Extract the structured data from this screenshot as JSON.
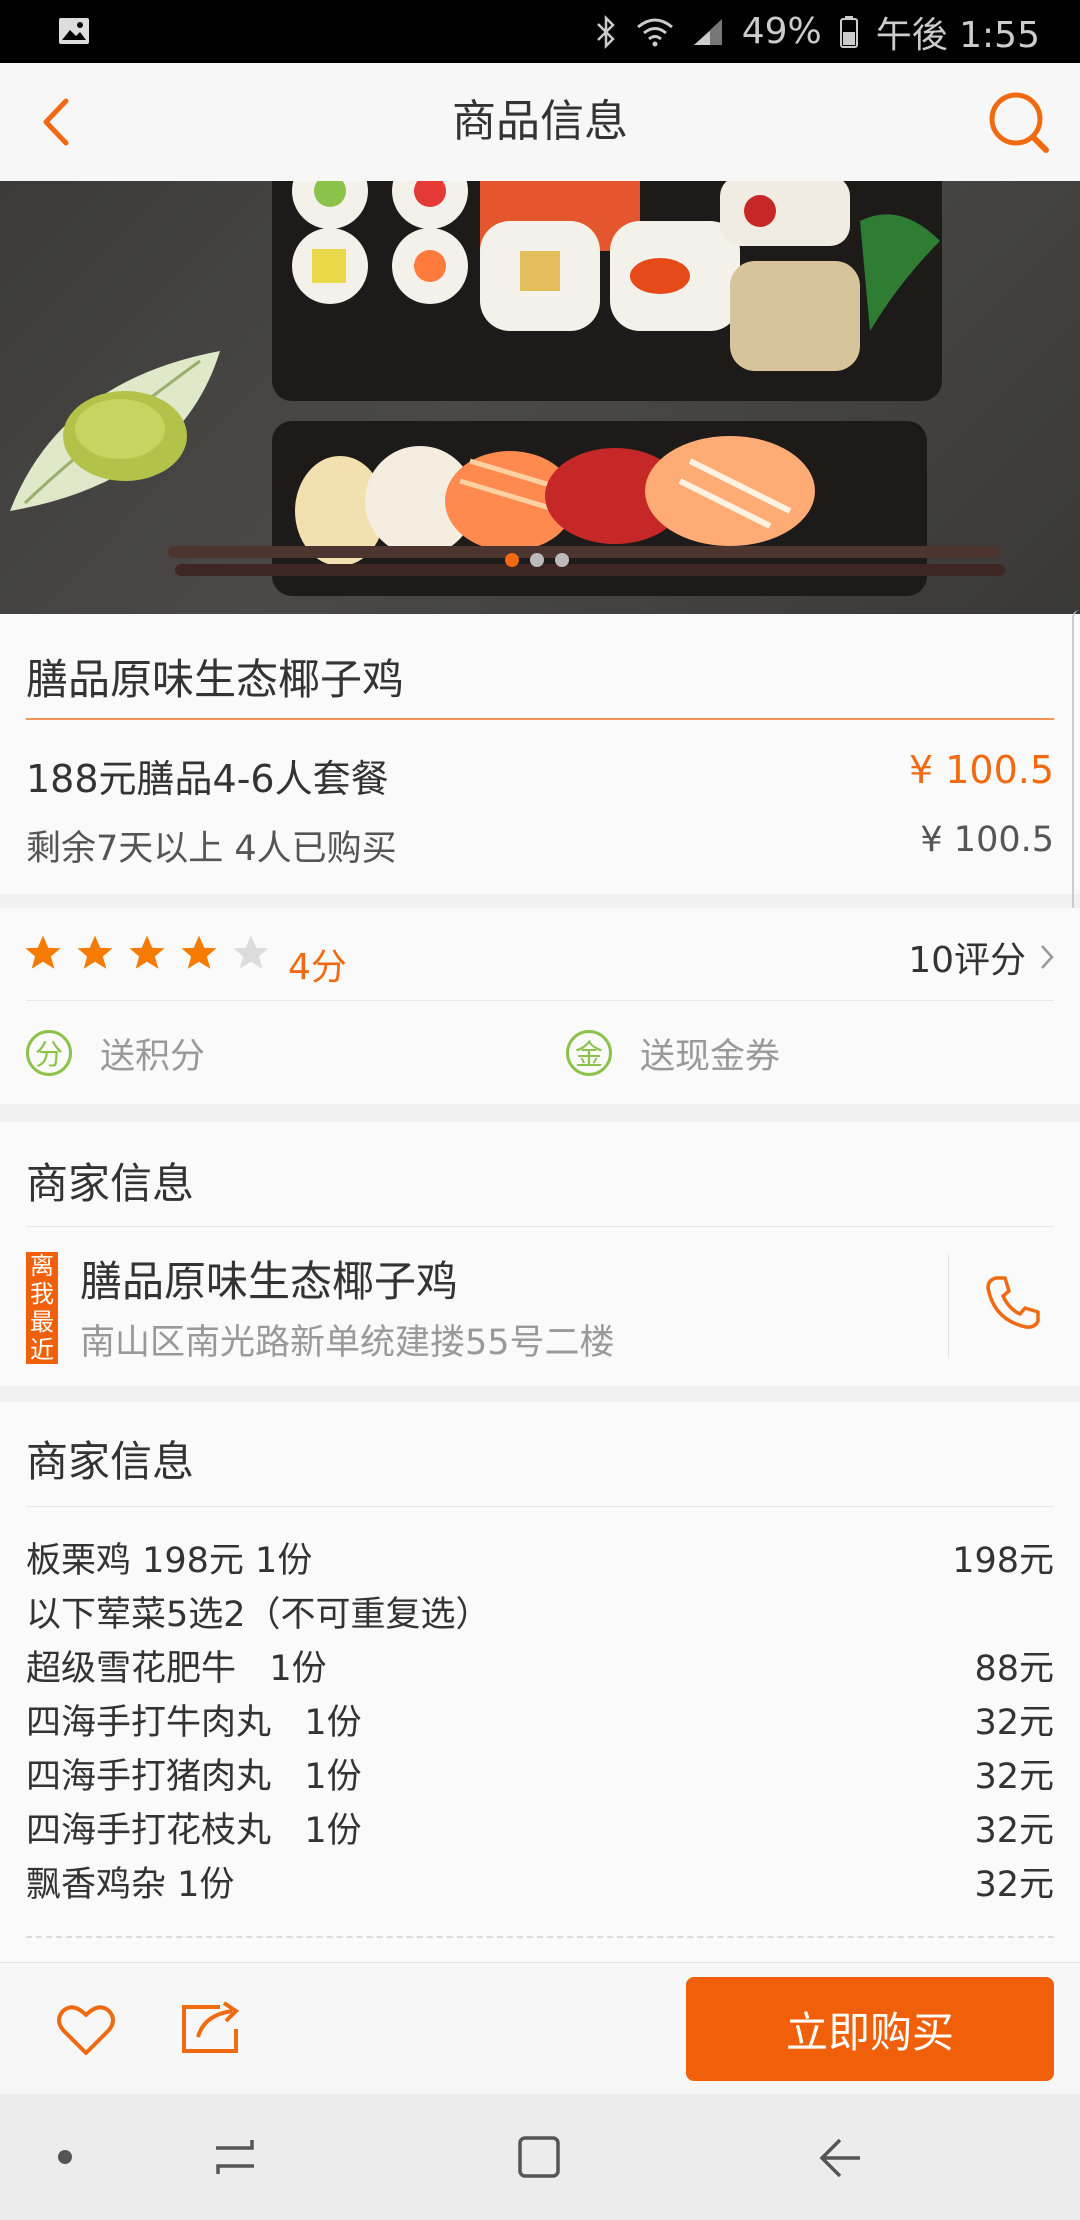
{
  "status_bar": {
    "battery": "49%",
    "time": "午後 1:55"
  },
  "header": {
    "title": "商品信息",
    "back_icon": "chevron-left-icon",
    "search_icon": "search-icon"
  },
  "hero": {
    "slide_count": 3,
    "active_index": 0
  },
  "product": {
    "name": "膳品原味生态椰子鸡",
    "package": "188元膳品4-6人套餐",
    "price": "¥ 100.5",
    "remaining": "剩余7天以上  4人已购买",
    "original_price": "¥ 100.5"
  },
  "rating": {
    "stars": 4,
    "max_stars": 5,
    "score_text": "4分",
    "reviews": "10评分"
  },
  "perks": [
    {
      "badge": "分",
      "label": "送积分"
    },
    {
      "badge": "金",
      "label": "送现金券"
    }
  ],
  "merchant": {
    "section_title": "商家信息",
    "tag": "离我最近",
    "name": "膳品原味生态椰子鸡",
    "address": "南山区南光路新单统建搂55号二楼"
  },
  "menu": {
    "section_title": "商家信息",
    "items": [
      {
        "name": "板栗鸡 198元 1份",
        "price": "198元"
      },
      {
        "name": "以下荤菜5选2（不可重复选）",
        "price": ""
      },
      {
        "name": "超级雪花肥牛   1份",
        "price": "88元"
      },
      {
        "name": "四海手打牛肉丸   1份",
        "price": "32元"
      },
      {
        "name": "四海手打猪肉丸   1份",
        "price": "32元"
      },
      {
        "name": "四海手打花枝丸   1份",
        "price": "32元"
      },
      {
        "name": "飘香鸡杂 1份",
        "price": "32元"
      }
    ]
  },
  "bottom_bar": {
    "buy_label": "立即购买"
  },
  "colors": {
    "accent": "#f06a12",
    "button": "#f05f0a",
    "perk_green": "#8bc34a",
    "star": "#f57c00"
  }
}
